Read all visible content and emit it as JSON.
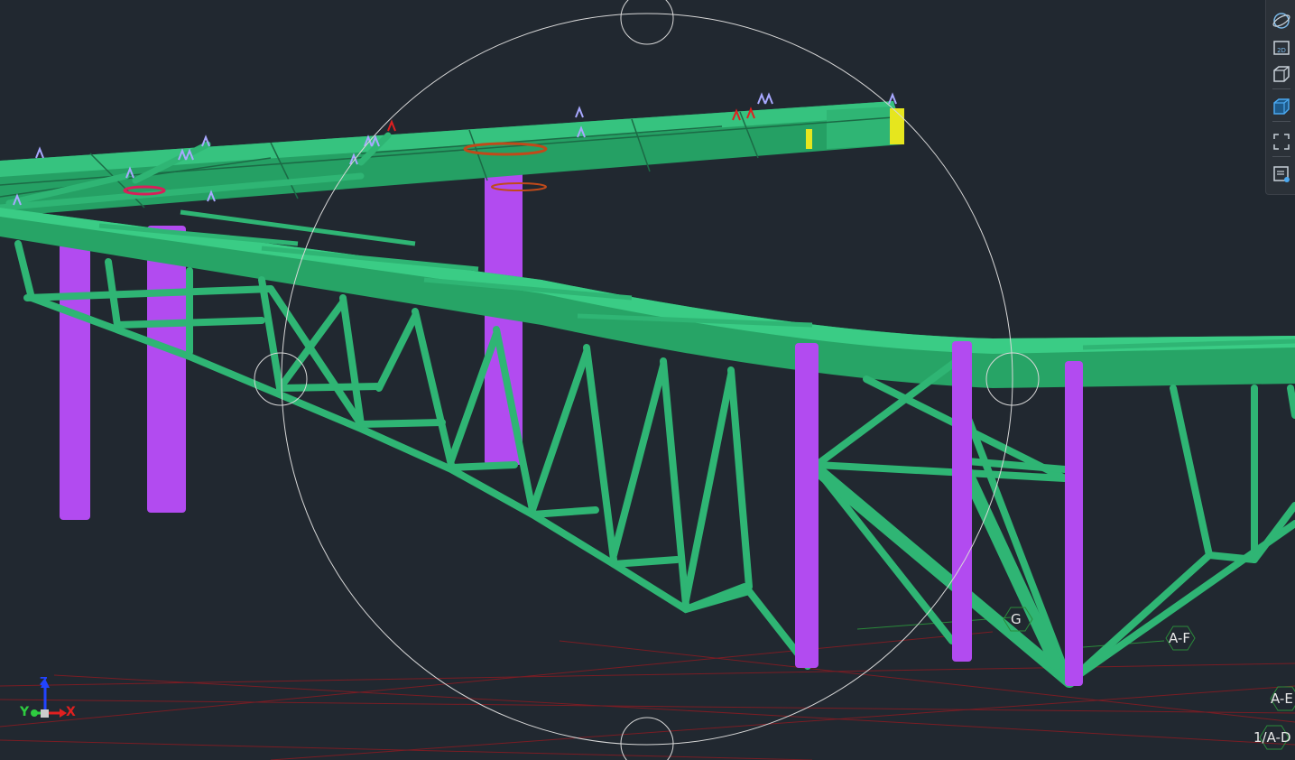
{
  "viewport": {
    "background": "#212830",
    "structure_color": "#2fb574",
    "column_color": "#b24bf0",
    "end_plate_color": "#e6e61e",
    "support_marker_color": "#a8a8ff",
    "warning_marker_color": "#e02020"
  },
  "grid_labels": {
    "g": "G",
    "af": "A-F",
    "ae": "A-E",
    "ad": "1/A-D"
  },
  "axis_indicator": {
    "x": "X",
    "y": "Y",
    "z": "Z"
  },
  "toolbar": {
    "items": [
      {
        "name": "orbit",
        "icon": "orbit-icon"
      },
      {
        "name": "2d-view",
        "icon": "2d-view-icon",
        "label": "2D"
      },
      {
        "name": "3d-view",
        "icon": "3d-box-icon"
      },
      {
        "name": "shaded-view",
        "icon": "shaded-box-icon"
      },
      {
        "name": "fit-view",
        "icon": "fit-view-icon"
      },
      {
        "name": "view-properties",
        "icon": "view-properties-icon"
      }
    ]
  }
}
